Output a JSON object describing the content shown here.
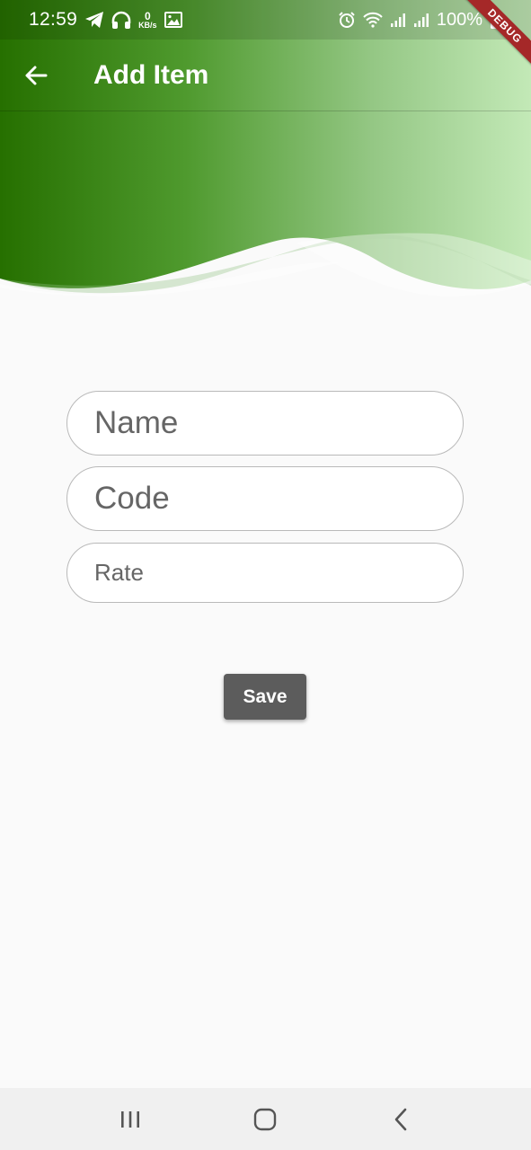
{
  "status_bar": {
    "time": "12:59",
    "data_rate_value": "0",
    "data_rate_unit": "KB/s",
    "battery_text": "100%",
    "icons": [
      "telegram-icon",
      "headphones-icon",
      "data-rate-icon",
      "gallery-icon",
      "alarm-icon",
      "wifi-icon",
      "signal-icon",
      "signal-icon",
      "battery-icon"
    ]
  },
  "debug_banner": "DEBUG",
  "app_bar": {
    "title": "Add Item",
    "back_icon": "arrow-back-icon"
  },
  "form": {
    "name_placeholder": "Name",
    "code_placeholder": "Code",
    "rate_placeholder": "Rate",
    "save_label": "Save"
  },
  "nav_bar": {
    "icons": [
      "recent-apps-icon",
      "home-icon",
      "back-icon"
    ]
  },
  "colors": {
    "header_dark": "#2a7300",
    "header_light": "#c1e8b5",
    "background": "#fafafa",
    "save_button": "#5c5c5c",
    "field_border": "#b9b9b9"
  }
}
